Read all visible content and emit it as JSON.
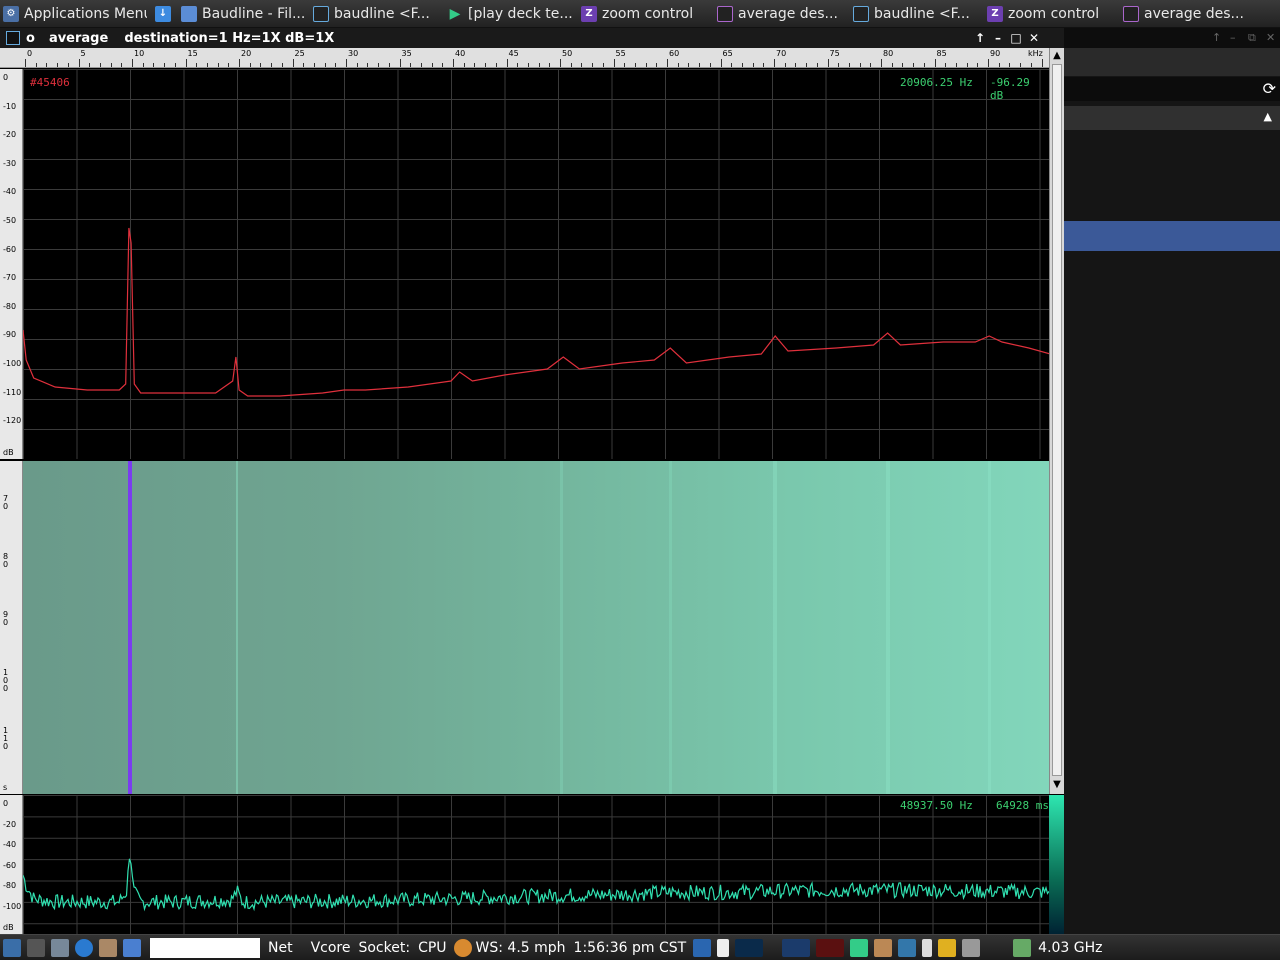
{
  "taskbar_top": {
    "items": [
      {
        "label": "Applications Menu",
        "icon": "apps-menu-icon"
      },
      {
        "label": "",
        "icon": "download-icon"
      },
      {
        "label": "Baudline - Fil...",
        "icon": "folder-icon"
      },
      {
        "label": "baudline  <F...",
        "icon": "baudline-icon"
      },
      {
        "label": "[play deck  te...",
        "icon": "play-icon"
      },
      {
        "label": "zoom control",
        "icon": "zoom-icon"
      },
      {
        "label": "average   des...",
        "icon": "average-icon"
      },
      {
        "label": "baudline  <F...",
        "icon": "baudline-icon"
      },
      {
        "label": "zoom control",
        "icon": "zoom-icon"
      },
      {
        "label": "average   des...",
        "icon": "average-icon"
      }
    ]
  },
  "window": {
    "title_o": "o",
    "title": "average",
    "subtitle": "destination=1 Hz=1X dB=1X",
    "buttons": {
      "up": "↑",
      "min": "–",
      "max": "□",
      "close": "✕"
    }
  },
  "ruler": {
    "labels": [
      "0",
      "5",
      "10",
      "15",
      "20",
      "25",
      "30",
      "35",
      "40",
      "45",
      "50",
      "55",
      "60",
      "65",
      "70",
      "75",
      "80",
      "85",
      "90"
    ],
    "unit": "kHz"
  },
  "spectrum": {
    "y_labels": [
      "0",
      "-10",
      "-20",
      "-30",
      "-40",
      "-50",
      "-60",
      "-70",
      "-80",
      "-90",
      "-100",
      "-110",
      "-120"
    ],
    "y_unit": "dB",
    "sample_label": "#45406",
    "freq_readout": "20906.25 Hz",
    "db_readout": "-96.29 dB",
    "trace_color": "#e0303c"
  },
  "waterfall": {
    "y_labels": [
      "7 0",
      "8 0",
      "9 0",
      "1 0 0",
      "1 1 0"
    ],
    "y_unit": "s",
    "marker_color": "#7a3cf0"
  },
  "bottom_panel": {
    "y_labels": [
      "0",
      "-20",
      "-40",
      "-60",
      "-80",
      "-100"
    ],
    "y_unit": "dB",
    "freq_readout": "48937.50 Hz",
    "time_readout": "64928 ms",
    "trace_color": "#30e0b0"
  },
  "chart_data": [
    {
      "type": "line",
      "title": "",
      "xlabel": "kHz",
      "ylabel": "dB",
      "xlim": [
        0,
        96
      ],
      "ylim": [
        -130,
        0
      ],
      "series": [
        {
          "x": [
            0,
            0.3,
            1,
            3,
            6,
            9,
            9.6,
            9.9,
            10.1,
            10.4,
            11,
            14,
            18,
            19.6,
            19.9,
            20.2,
            21,
            24,
            28,
            30,
            32,
            36,
            40,
            40.8,
            42,
            45,
            49,
            50.5,
            52,
            56,
            59,
            60.5,
            62,
            66,
            69,
            70.3,
            71.5,
            76,
            79.5,
            80.8,
            82,
            86,
            89,
            90.3,
            91.5,
            94,
            96
          ],
          "values": [
            -87,
            -97,
            -103,
            -106,
            -107,
            -107,
            -105,
            -53,
            -58,
            -105,
            -108,
            -108,
            -108,
            -104,
            -96,
            -107,
            -109,
            -109,
            -108,
            -107,
            -107,
            -106,
            -104,
            -101,
            -104,
            -102,
            -100,
            -96,
            -100,
            -98,
            -97,
            -93,
            -98,
            -96,
            -95,
            -89,
            -94,
            -93,
            -92,
            -88,
            -92,
            -91,
            -91,
            -89,
            -91,
            -93,
            -95
          ]
        }
      ]
    },
    {
      "type": "line",
      "title": "",
      "xlabel": "",
      "ylabel": "dB",
      "xlim": [
        0,
        96
      ],
      "ylim": [
        -130,
        0
      ],
      "series": [
        {
          "x": [
            0,
            0.3,
            1,
            3,
            6,
            9,
            9.7,
            10,
            10.3,
            11,
            14,
            19.5,
            20,
            20.5,
            24,
            30,
            36,
            40,
            46,
            50,
            56,
            60,
            66,
            70,
            76,
            80,
            86,
            90,
            96
          ],
          "values": [
            -75,
            -85,
            -97,
            -100,
            -100,
            -100,
            -90,
            -48,
            -90,
            -100,
            -100,
            -98,
            -90,
            -100,
            -100,
            -99,
            -98,
            -97,
            -95,
            -94,
            -93,
            -91,
            -91,
            -90,
            -89,
            -89,
            -89,
            -90,
            -91
          ]
        }
      ]
    }
  ],
  "taskbar_bottom": {
    "net": "Net",
    "vcore": "Vcore",
    "socket": "Socket:",
    "cpu": "CPU",
    "weather": "WS: 4.5 mph",
    "clock": "1:56:36 pm CST",
    "cpu_freq": "4.03 GHz"
  }
}
